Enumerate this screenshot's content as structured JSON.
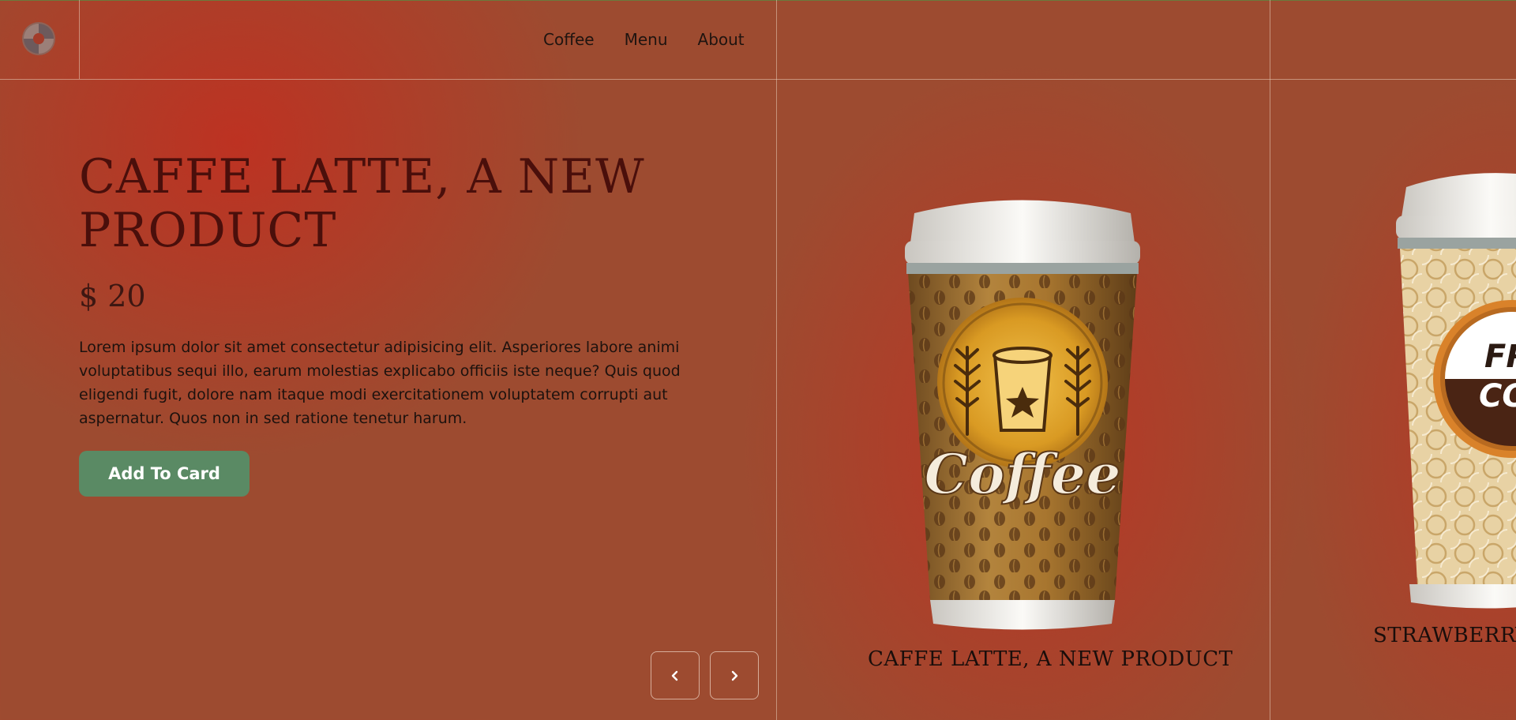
{
  "nav": {
    "items": [
      {
        "label": "Coffee"
      },
      {
        "label": "Menu"
      },
      {
        "label": "About"
      }
    ]
  },
  "hero": {
    "title": "CAFFE LATTE, A NEW PRODUCT",
    "price": "$ 20",
    "description": "Lorem ipsum dolor sit amet consectetur adipisicing elit. Asperiores labore animi voluptatibus sequi illo, earum molestias explicabo officiis iste neque? Quis quod eligendi fugit, dolore nam itaque modi exercitationem voluptatem corrupti aut aspernatur. Quos non in sed ratione tenetur harum.",
    "button_label": "Add To Card"
  },
  "carousel": {
    "cards": [
      {
        "label": "CAFFE LATTE, A NEW PRODUCT",
        "cup_text": "Coffee"
      },
      {
        "label": "STRAWBERRY",
        "cup_text": "FRESH COFFEE"
      }
    ],
    "prev_icon": "chevron-left-icon",
    "next_icon": "chevron-right-icon"
  },
  "colors": {
    "background": "#9d4b30",
    "accent_glow": "#bd3222",
    "button": "#5a8a64",
    "title": "#4a0f0b",
    "text": "#1d120e"
  }
}
